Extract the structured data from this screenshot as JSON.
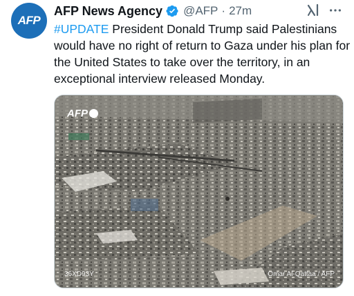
{
  "avatar": {
    "text": "AFP",
    "color": "#1d6fb8"
  },
  "header": {
    "display_name": "AFP News Agency",
    "verified_icon": "verified-badge-icon",
    "handle": "@AFP",
    "separator": "·",
    "time": "27m",
    "grok_icon": "grok-icon",
    "more_icon": "more-options-icon"
  },
  "tweet": {
    "hashtag": "#UPDATE",
    "body": " President Donald Trump said Palestinians would have no right of return to Gaza under his plan for the United States to take over the territory, in an exceptional interview released Monday."
  },
  "media": {
    "logo_text": "AFP",
    "photo_id": "36XD93Y",
    "credit": "Omar Al-Qattaa / AFP"
  },
  "colors": {
    "accent": "#1d9bf0",
    "text": "#0f1419",
    "secondary": "#536471"
  }
}
